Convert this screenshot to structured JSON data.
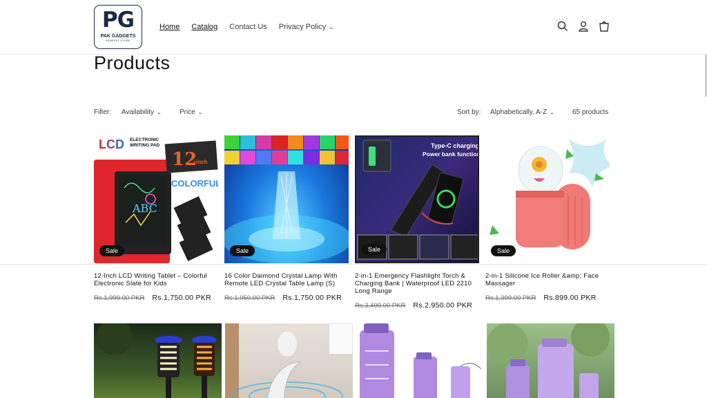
{
  "header": {
    "logo_mark": "PG",
    "logo_name": "PAK GADGETS",
    "logo_sub": "GENERAL STORE",
    "nav": [
      {
        "label": "Home"
      },
      {
        "label": "Catalog"
      },
      {
        "label": "Contact Us"
      },
      {
        "label": "Privacy Policy"
      }
    ],
    "icons": [
      "search-icon",
      "account-icon",
      "cart-icon"
    ]
  },
  "page": {
    "title": "Products"
  },
  "filters": {
    "filter_label": "Filter:",
    "availability": "Availability",
    "price": "Price",
    "sort_label": "Sort by:",
    "sort_value": "Alphabetically, A-Z",
    "count": "65 products"
  },
  "products": [
    {
      "title": "12-Inch LCD Writing Tablet – Colorful Electronic Slate for Kids",
      "old_price": "Rs.1,999.00 PKR",
      "price": "Rs.1,750.00 PKR",
      "badge": "Sale",
      "img_text_1": "LCD",
      "img_text_2": "ELECTRONIC WRITING PAD",
      "img_text_3": "12",
      "img_text_4": "inch",
      "img_text_5": "COLORFUL",
      "img_text_6": "ABC"
    },
    {
      "title": "16 Color Daimond Crystal Lamp With Remote LED Crystal Table Lamp (S)",
      "old_price": "Rs.1,950.00 PKR",
      "price": "Rs.1,750.00 PKR",
      "badge": "Sale"
    },
    {
      "title": "2-in-1 Emergency Flashlight Torch & Charging Bank | Waterproof LED 2210 Long Range",
      "old_price": "Rs.3,499.00 PKR",
      "price": "Rs.2,950.00 PKR",
      "badge": "Sale",
      "img_text_1": "Type-C charging",
      "img_text_2": "Power bank function"
    },
    {
      "title": "2-in-1 Silicone Ice Roller &amp; Face Massager",
      "old_price": "Rs.1,399.00 PKR",
      "price": "Rs.899.00 PKR",
      "badge": "Sale"
    }
  ],
  "row2": [
    {
      "name": "solar-lamp-product"
    },
    {
      "name": "levitating-lamp-product"
    },
    {
      "name": "water-bottle-set-product"
    },
    {
      "name": "water-bottle-set-2-product"
    }
  ]
}
